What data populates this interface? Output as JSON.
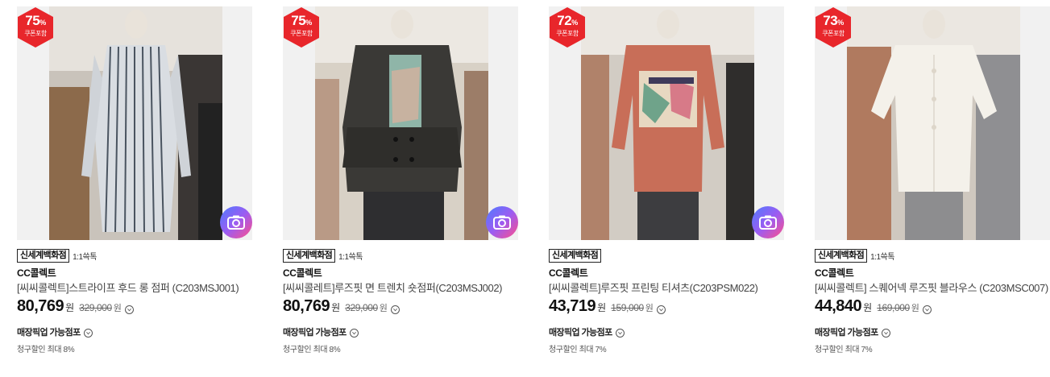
{
  "products": [
    {
      "discount_pct": "75",
      "pct_sign": "%",
      "coupon_label": "쿠폰포함",
      "store": "신세계백화점",
      "chat": "1:1쓱톡",
      "brand": "CC콜렉트",
      "name": "[씨씨콜렉트]스트라이프 후드 롱 점퍼 (C203MSJ001)",
      "price": "80,769",
      "currency": "원",
      "original_price": "329,000",
      "pickup": "매장픽업 가능점포",
      "card_discount": "청구할인 최대 8%",
      "has_camera": true
    },
    {
      "discount_pct": "75",
      "pct_sign": "%",
      "coupon_label": "쿠폰포함",
      "store": "신세계백화점",
      "chat": "1:1쓱톡",
      "brand": "CC콜렉트",
      "name": "[씨씨콜레트]루즈핏 면 트렌치 숏점퍼(C203MSJ002)",
      "price": "80,769",
      "currency": "원",
      "original_price": "329,000",
      "pickup": "매장픽업 가능점포",
      "card_discount": "청구할인 최대 8%",
      "has_camera": true
    },
    {
      "discount_pct": "72",
      "pct_sign": "%",
      "coupon_label": "쿠폰포함",
      "store": "신세계백화점",
      "chat": "",
      "brand": "CC콜렉트",
      "name": "[씨씨콜렉트]루즈핏 프린팅 티셔츠(C203PSM022)",
      "price": "43,719",
      "currency": "원",
      "original_price": "159,000",
      "pickup": "매장픽업 가능점포",
      "card_discount": "청구할인 최대 7%",
      "has_camera": true
    },
    {
      "discount_pct": "73",
      "pct_sign": "%",
      "coupon_label": "쿠폰포함",
      "store": "신세계백화점",
      "chat": "1:1쓱톡",
      "brand": "CC콜렉트",
      "name": "[씨씨콜렉트] 스퀘어넥 루즈핏 블라우스 (C203MSC007)",
      "price": "44,840",
      "currency": "원",
      "original_price": "169,000",
      "pickup": "매장픽업 가능점포",
      "card_discount": "청구할인 최대 7%",
      "has_camera": false
    }
  ],
  "icons": {
    "badge": "discount-hexagon-icon",
    "camera": "camera-icon",
    "info": "chevron-down-circle-icon"
  },
  "colors": {
    "badge": "#e8262b",
    "camera_gradient": [
      "#4e7bff",
      "#9b5cf2",
      "#ff4f8b"
    ]
  }
}
